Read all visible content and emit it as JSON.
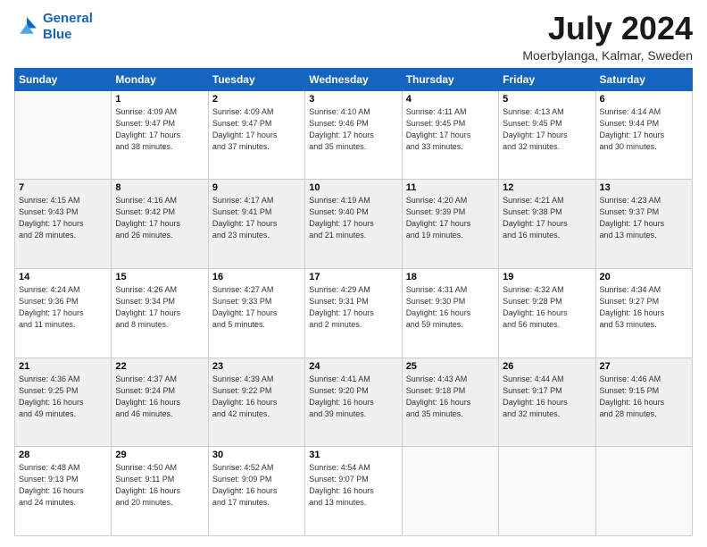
{
  "logo": {
    "line1": "General",
    "line2": "Blue"
  },
  "header": {
    "month": "July 2024",
    "location": "Moerbylanga, Kalmar, Sweden"
  },
  "days_of_week": [
    "Sunday",
    "Monday",
    "Tuesday",
    "Wednesday",
    "Thursday",
    "Friday",
    "Saturday"
  ],
  "weeks": [
    [
      {
        "day": "",
        "info": ""
      },
      {
        "day": "1",
        "info": "Sunrise: 4:09 AM\nSunset: 9:47 PM\nDaylight: 17 hours\nand 38 minutes."
      },
      {
        "day": "2",
        "info": "Sunrise: 4:09 AM\nSunset: 9:47 PM\nDaylight: 17 hours\nand 37 minutes."
      },
      {
        "day": "3",
        "info": "Sunrise: 4:10 AM\nSunset: 9:46 PM\nDaylight: 17 hours\nand 35 minutes."
      },
      {
        "day": "4",
        "info": "Sunrise: 4:11 AM\nSunset: 9:45 PM\nDaylight: 17 hours\nand 33 minutes."
      },
      {
        "day": "5",
        "info": "Sunrise: 4:13 AM\nSunset: 9:45 PM\nDaylight: 17 hours\nand 32 minutes."
      },
      {
        "day": "6",
        "info": "Sunrise: 4:14 AM\nSunset: 9:44 PM\nDaylight: 17 hours\nand 30 minutes."
      }
    ],
    [
      {
        "day": "7",
        "info": "Sunrise: 4:15 AM\nSunset: 9:43 PM\nDaylight: 17 hours\nand 28 minutes."
      },
      {
        "day": "8",
        "info": "Sunrise: 4:16 AM\nSunset: 9:42 PM\nDaylight: 17 hours\nand 26 minutes."
      },
      {
        "day": "9",
        "info": "Sunrise: 4:17 AM\nSunset: 9:41 PM\nDaylight: 17 hours\nand 23 minutes."
      },
      {
        "day": "10",
        "info": "Sunrise: 4:19 AM\nSunset: 9:40 PM\nDaylight: 17 hours\nand 21 minutes."
      },
      {
        "day": "11",
        "info": "Sunrise: 4:20 AM\nSunset: 9:39 PM\nDaylight: 17 hours\nand 19 minutes."
      },
      {
        "day": "12",
        "info": "Sunrise: 4:21 AM\nSunset: 9:38 PM\nDaylight: 17 hours\nand 16 minutes."
      },
      {
        "day": "13",
        "info": "Sunrise: 4:23 AM\nSunset: 9:37 PM\nDaylight: 17 hours\nand 13 minutes."
      }
    ],
    [
      {
        "day": "14",
        "info": "Sunrise: 4:24 AM\nSunset: 9:36 PM\nDaylight: 17 hours\nand 11 minutes."
      },
      {
        "day": "15",
        "info": "Sunrise: 4:26 AM\nSunset: 9:34 PM\nDaylight: 17 hours\nand 8 minutes."
      },
      {
        "day": "16",
        "info": "Sunrise: 4:27 AM\nSunset: 9:33 PM\nDaylight: 17 hours\nand 5 minutes."
      },
      {
        "day": "17",
        "info": "Sunrise: 4:29 AM\nSunset: 9:31 PM\nDaylight: 17 hours\nand 2 minutes."
      },
      {
        "day": "18",
        "info": "Sunrise: 4:31 AM\nSunset: 9:30 PM\nDaylight: 16 hours\nand 59 minutes."
      },
      {
        "day": "19",
        "info": "Sunrise: 4:32 AM\nSunset: 9:28 PM\nDaylight: 16 hours\nand 56 minutes."
      },
      {
        "day": "20",
        "info": "Sunrise: 4:34 AM\nSunset: 9:27 PM\nDaylight: 16 hours\nand 53 minutes."
      }
    ],
    [
      {
        "day": "21",
        "info": "Sunrise: 4:36 AM\nSunset: 9:25 PM\nDaylight: 16 hours\nand 49 minutes."
      },
      {
        "day": "22",
        "info": "Sunrise: 4:37 AM\nSunset: 9:24 PM\nDaylight: 16 hours\nand 46 minutes."
      },
      {
        "day": "23",
        "info": "Sunrise: 4:39 AM\nSunset: 9:22 PM\nDaylight: 16 hours\nand 42 minutes."
      },
      {
        "day": "24",
        "info": "Sunrise: 4:41 AM\nSunset: 9:20 PM\nDaylight: 16 hours\nand 39 minutes."
      },
      {
        "day": "25",
        "info": "Sunrise: 4:43 AM\nSunset: 9:18 PM\nDaylight: 16 hours\nand 35 minutes."
      },
      {
        "day": "26",
        "info": "Sunrise: 4:44 AM\nSunset: 9:17 PM\nDaylight: 16 hours\nand 32 minutes."
      },
      {
        "day": "27",
        "info": "Sunrise: 4:46 AM\nSunset: 9:15 PM\nDaylight: 16 hours\nand 28 minutes."
      }
    ],
    [
      {
        "day": "28",
        "info": "Sunrise: 4:48 AM\nSunset: 9:13 PM\nDaylight: 16 hours\nand 24 minutes."
      },
      {
        "day": "29",
        "info": "Sunrise: 4:50 AM\nSunset: 9:11 PM\nDaylight: 16 hours\nand 20 minutes."
      },
      {
        "day": "30",
        "info": "Sunrise: 4:52 AM\nSunset: 9:09 PM\nDaylight: 16 hours\nand 17 minutes."
      },
      {
        "day": "31",
        "info": "Sunrise: 4:54 AM\nSunset: 9:07 PM\nDaylight: 16 hours\nand 13 minutes."
      },
      {
        "day": "",
        "info": ""
      },
      {
        "day": "",
        "info": ""
      },
      {
        "day": "",
        "info": ""
      }
    ]
  ]
}
